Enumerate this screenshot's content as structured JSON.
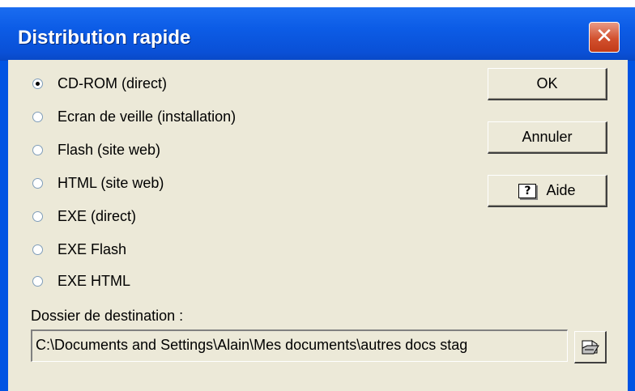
{
  "window": {
    "title": "Distribution rapide",
    "close_symbol": "✕"
  },
  "options": [
    {
      "label": "CD-ROM (direct)",
      "selected": true
    },
    {
      "label": "Ecran de veille (installation)",
      "selected": false
    },
    {
      "label": "Flash (site web)",
      "selected": false
    },
    {
      "label": "HTML (site web)",
      "selected": false
    },
    {
      "label": "EXE (direct)",
      "selected": false
    },
    {
      "label": "EXE Flash",
      "selected": false
    },
    {
      "label": "EXE HTML",
      "selected": false
    }
  ],
  "buttons": {
    "ok": "OK",
    "cancel": "Annuler",
    "help": "Aide",
    "help_icon_glyph": "?"
  },
  "destination": {
    "label": "Dossier de destination :",
    "path": "C:\\Documents and Settings\\Alain\\Mes documents\\autres docs stag"
  },
  "colors": {
    "titlebar": "#0a50d6",
    "dialog_bg": "#ece9d8",
    "close": "#d2512f"
  }
}
